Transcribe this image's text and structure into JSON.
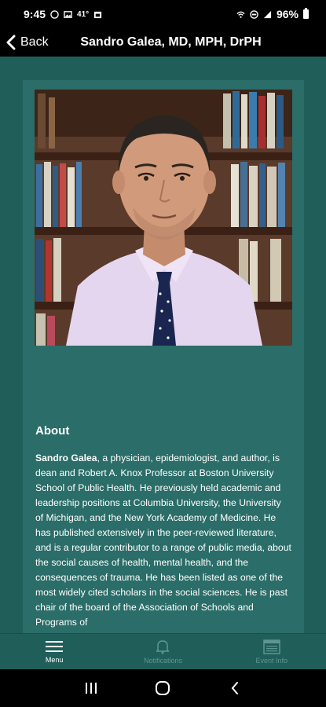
{
  "status_bar": {
    "time": "9:45",
    "temperature": "41°",
    "battery": "96%"
  },
  "header": {
    "back_label": "Back",
    "title": "Sandro Galea, MD, MPH, DrPH"
  },
  "about": {
    "title": "About",
    "name": "Sandro Galea",
    "body": ", a physician, epidemiologist, and author, is dean and Robert A. Knox Professor at Boston University School of Public Health. He previously held academic and leadership positions at Columbia University, the University of Michigan, and the New York Academy of Medicine. He has published extensively in the peer-reviewed literature, and is a regular contributor to a range of public media, about the social causes of health, mental health, and the consequences of trauma. He has been listed as one of the most widely cited scholars in the social sciences. He is past chair of the board of the Association of Schools and Programs of"
  },
  "bottom_nav": {
    "items": [
      {
        "label": "Menu",
        "icon": "hamburger-icon"
      },
      {
        "label": "Notifications",
        "icon": "bell-icon"
      },
      {
        "label": "Event Info",
        "icon": "calendar-icon"
      }
    ]
  },
  "colors": {
    "background": "#1f5e59",
    "card": "#2b6d68",
    "inactive_nav": "#5e9791"
  }
}
